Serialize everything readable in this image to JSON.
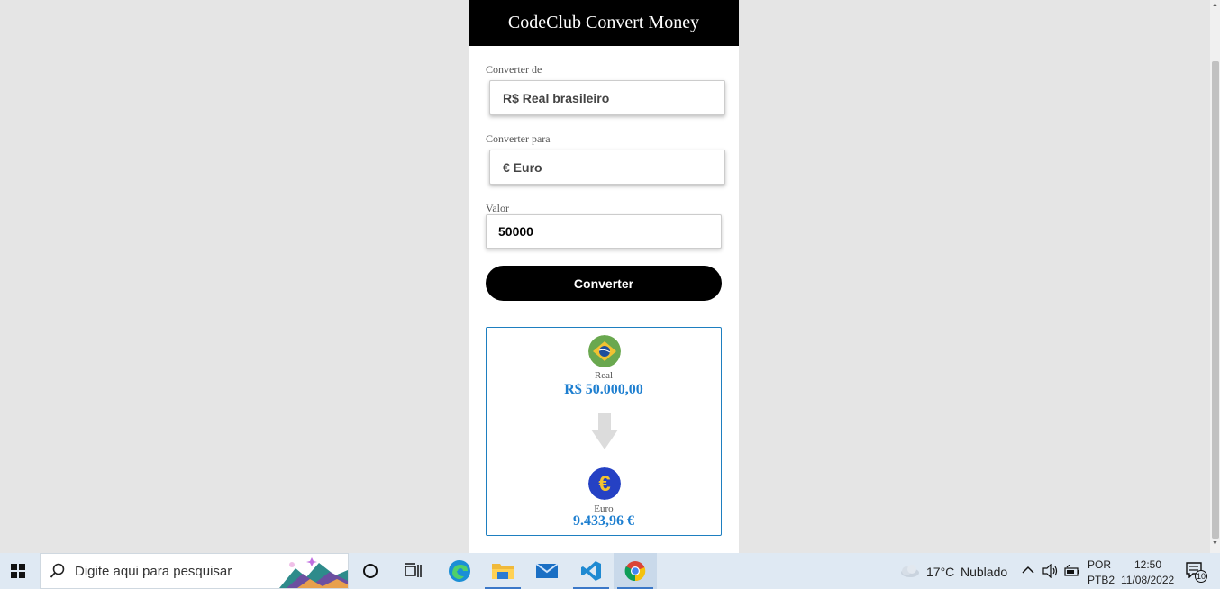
{
  "app": {
    "title": "CodeClub Convert Money",
    "from_label": "Converter de",
    "from_value": "R$ Real brasileiro",
    "to_label": "Converter para",
    "to_value": "€ Euro",
    "amount_label": "Valor",
    "amount_value": "50000",
    "convert_button": "Converter",
    "result": {
      "source_name": "Real",
      "source_value": "R$ 50.000,00",
      "target_name": "Euro",
      "target_value": "9.433,96 €",
      "source_flag_icon": "brazil-flag-icon",
      "target_flag_icon": "euro-icon"
    },
    "colors": {
      "header_bg": "#000000",
      "value_blue": "#1e7fd0",
      "result_border": "#1e7fc0"
    }
  },
  "taskbar": {
    "search_placeholder": "Digite aqui para pesquisar",
    "weather_temp": "17°C",
    "weather_desc": "Nublado",
    "language": "POR",
    "keyboard": "PTB2",
    "time": "12:50",
    "date": "11/08/2022",
    "notifications_count": "10"
  }
}
